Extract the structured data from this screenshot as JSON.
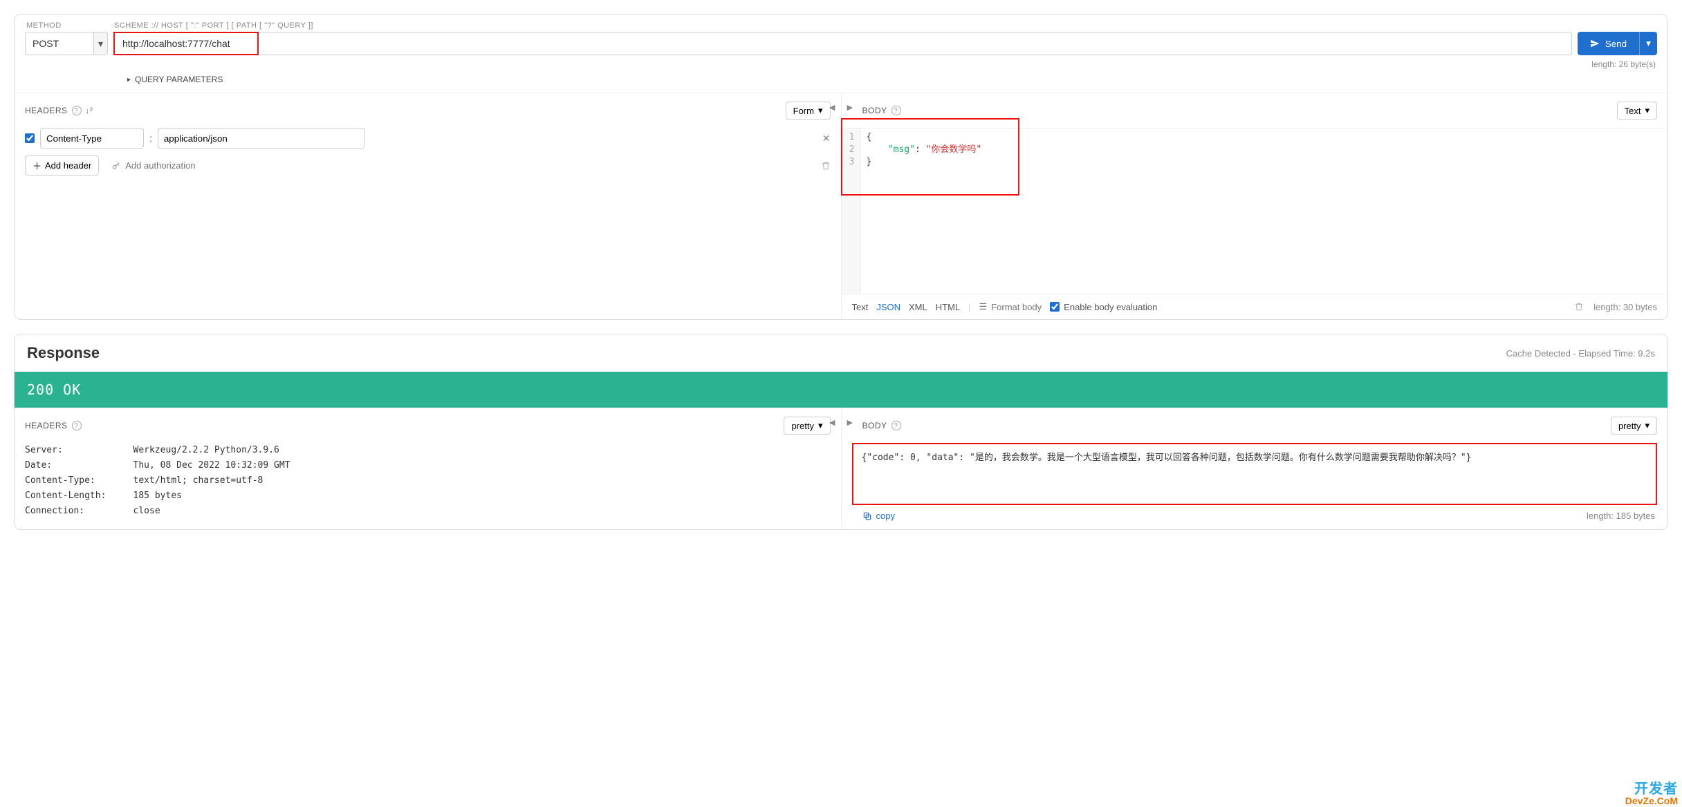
{
  "request": {
    "labels": {
      "method": "METHOD",
      "url": "SCHEME :// HOST [ \":\" PORT ] [ PATH [ \"?\" QUERY ]]"
    },
    "method": "POST",
    "url": "http://localhost:7777/chat",
    "send_label": "Send",
    "length_text": "length: 26 byte(s)",
    "query_params_label": "QUERY PARAMETERS"
  },
  "req_headers": {
    "title": "HEADERS",
    "form_label": "Form",
    "items": [
      {
        "enabled": true,
        "name": "Content-Type",
        "value": "application/json"
      }
    ],
    "add_header_label": "Add header",
    "add_auth_label": "Add authorization"
  },
  "req_body": {
    "title": "BODY",
    "mode_label": "Text",
    "lines": [
      "{",
      "    \"msg\": \"你会数学吗\"",
      "}"
    ],
    "json_key": "\"msg\"",
    "json_val": "\"你会数学吗\"",
    "tabs": {
      "text": "Text",
      "json": "JSON",
      "xml": "XML",
      "html": "HTML"
    },
    "format_label": "Format body",
    "enable_eval_label": "Enable body evaluation",
    "length_text": "length: 30 bytes"
  },
  "response": {
    "title": "Response",
    "meta": "Cache Detected - Elapsed Time: 9.2s",
    "status": "200 OK"
  },
  "resp_headers": {
    "title": "HEADERS",
    "mode_label": "pretty",
    "rows": [
      {
        "k": "Server:",
        "v": "Werkzeug/2.2.2 Python/3.9.6"
      },
      {
        "k": "Date:",
        "v": "Thu, 08 Dec 2022 10:32:09 GMT"
      },
      {
        "k": "Content-Type:",
        "v": "text/html; charset=utf-8"
      },
      {
        "k": "Content-Length:",
        "v": "185 bytes"
      },
      {
        "k": "Connection:",
        "v": "close"
      }
    ]
  },
  "resp_body": {
    "title": "BODY",
    "mode_label": "pretty",
    "content": "{\"code\": 0, \"data\": \"是的，我会数学。我是一个大型语言模型，我可以回答各种问题，包括数学问题。你有什么数学问题需要我帮助你解决吗？\"}",
    "copy_label": "copy",
    "length_text": "length: 185 bytes"
  },
  "watermark": {
    "line1": "开发者",
    "line2": "DevZe.CoM"
  }
}
